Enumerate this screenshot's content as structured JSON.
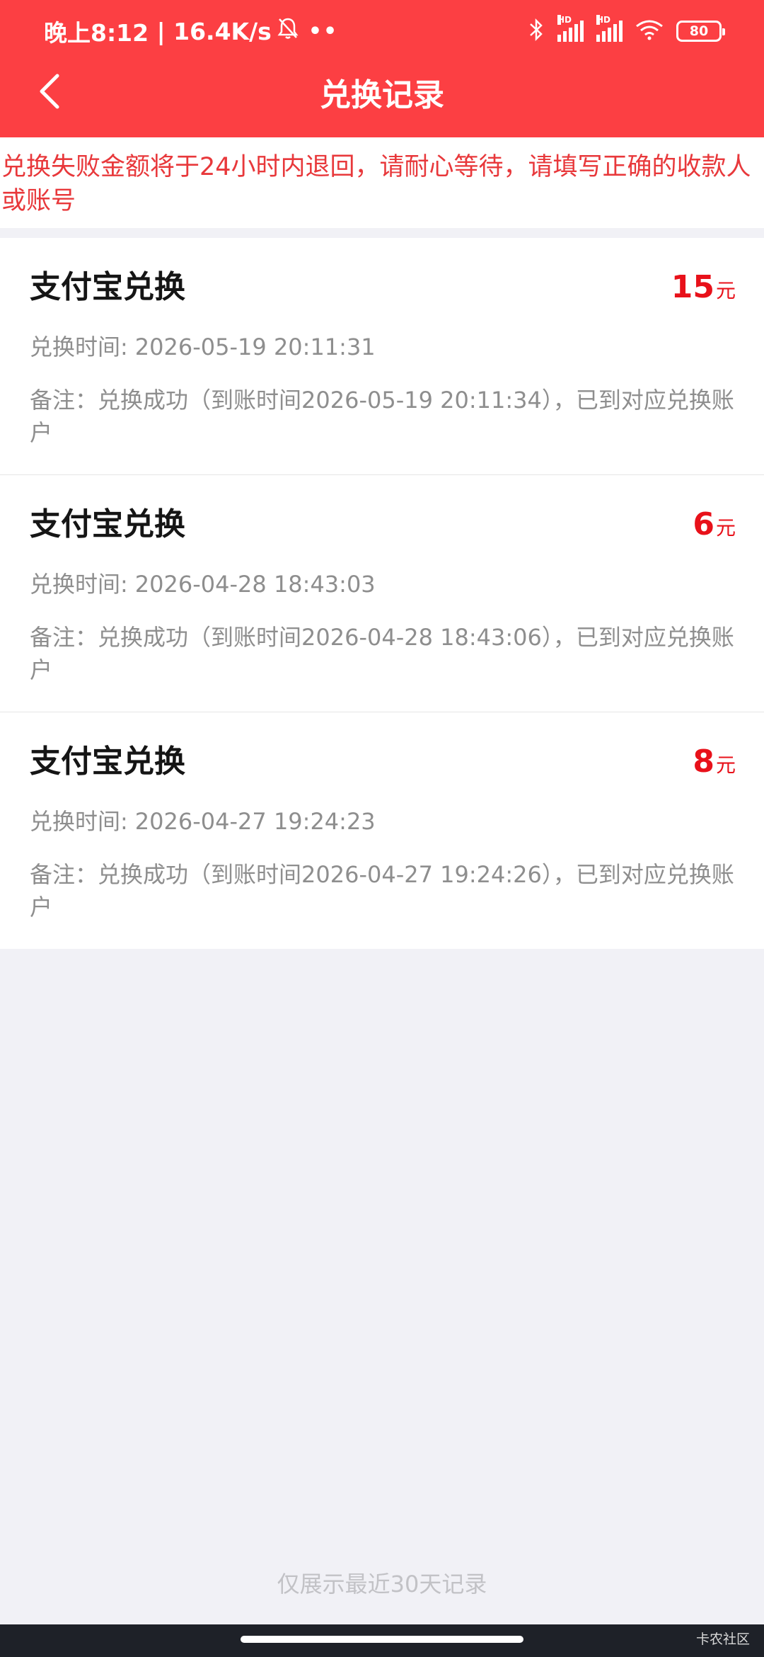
{
  "status_bar": {
    "time": "晚上8:12",
    "network_speed": "16.4K/s",
    "battery": "80",
    "icons": [
      "bell-off-icon",
      "bluetooth-icon",
      "signal-icon",
      "signal-icon",
      "wifi-icon",
      "battery-icon"
    ]
  },
  "header": {
    "title": "兑换记录",
    "back_icon": "chevron-left-icon",
    "bg_color": "#fc3f43"
  },
  "notice": {
    "text": "兑换失败金额将于24小时内退回，请耐心等待，请填写正确的收款人或账号"
  },
  "records": [
    {
      "title": "支付宝兑换",
      "amount": "15",
      "unit": "元",
      "time_label": "兑换时间:",
      "time": "2026-05-19 20:11:31",
      "note": "备注：兑换成功（到账时间2026-05-19 20:11:34），已到对应兑换账户"
    },
    {
      "title": "支付宝兑换",
      "amount": "6",
      "unit": "元",
      "time_label": "兑换时间:",
      "time": "2026-04-28 18:43:03",
      "note": "备注：兑换成功（到账时间2026-04-28 18:43:06），已到对应兑换账户"
    },
    {
      "title": "支付宝兑换",
      "amount": "8",
      "unit": "元",
      "time_label": "兑换时间:",
      "time": "2026-04-27 19:24:23",
      "note": "备注：兑换成功（到账时间2026-04-27 19:24:26），已到对应兑换账户"
    }
  ],
  "footer": {
    "text": "仅展示最近30天记录"
  },
  "watermark": "卡农社区",
  "colors": {
    "accent": "#fc3f43",
    "amount": "#e8111a",
    "notice": "#e8383b",
    "muted": "#8e8e8e"
  }
}
